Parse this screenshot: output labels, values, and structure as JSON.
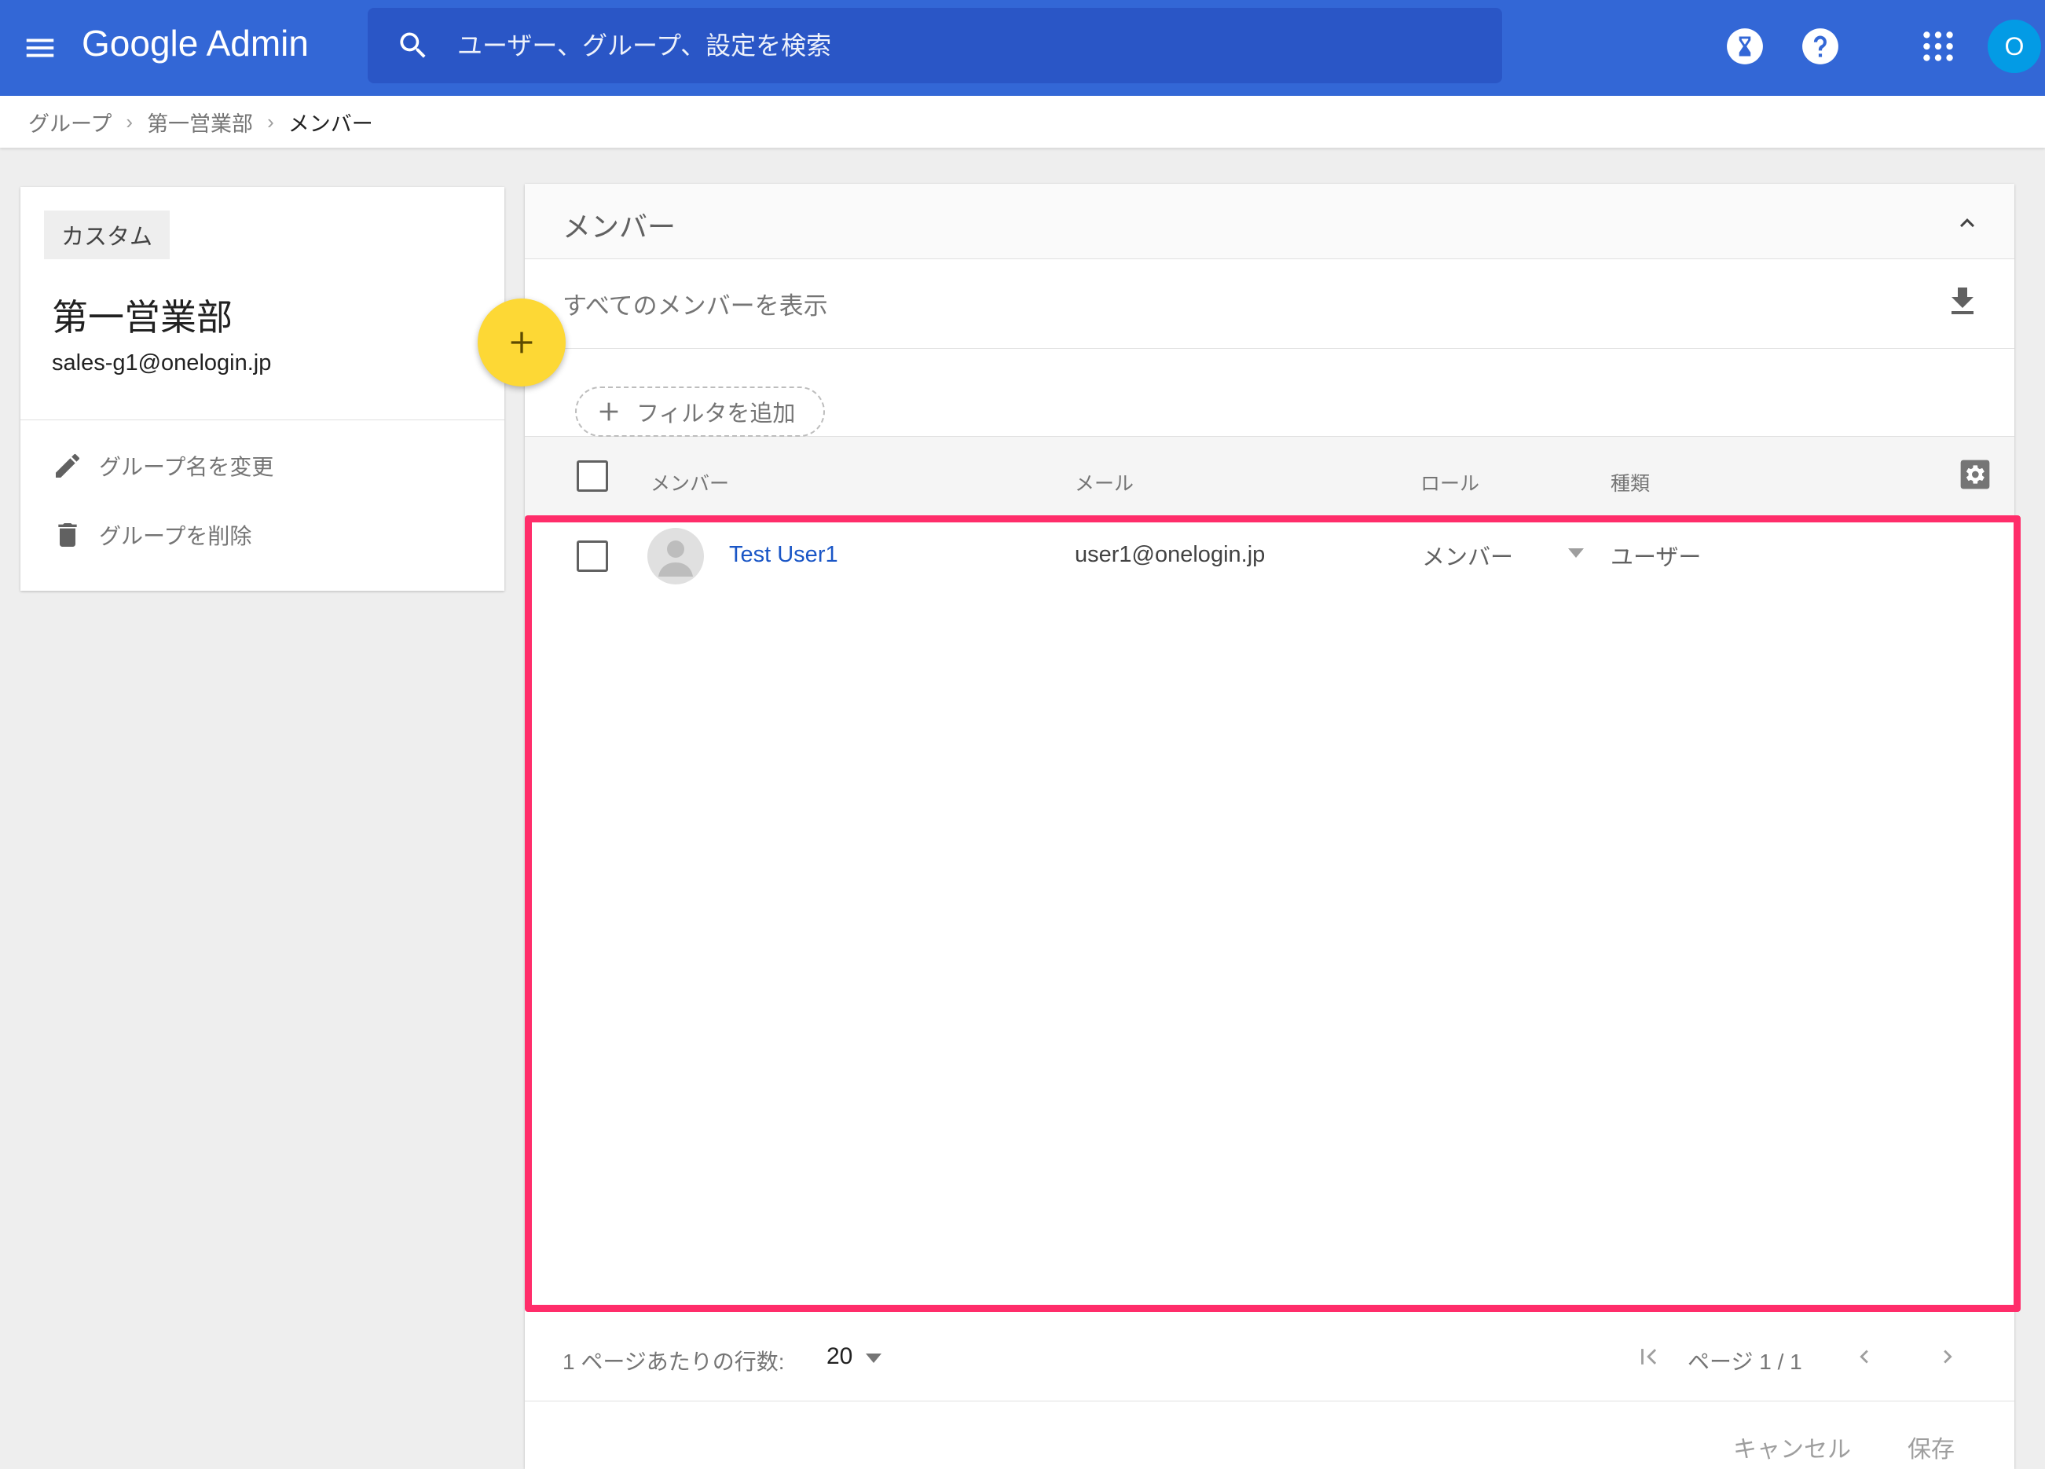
{
  "app": {
    "title": "Google Admin"
  },
  "search": {
    "placeholder": "ユーザー、グループ、設定を検索"
  },
  "account": {
    "initial": "O"
  },
  "breadcrumb": {
    "items": [
      "グループ",
      "第一営業部"
    ],
    "current": "メンバー"
  },
  "group": {
    "chip": "カスタム",
    "name": "第一営業部",
    "email": "sales-g1@onelogin.jp",
    "actions": {
      "rename": "グループ名を変更",
      "delete": "グループを削除"
    }
  },
  "members_panel": {
    "title": "メンバー",
    "show_all": "すべてのメンバーを表示",
    "add_filter": "フィルタを追加",
    "columns": {
      "member": "メンバー",
      "email": "メール",
      "role": "ロール",
      "type": "種類"
    },
    "rows": [
      {
        "name": "Test User1",
        "email": "user1@onelogin.jp",
        "role": "メンバー",
        "type": "ユーザー"
      }
    ]
  },
  "pagination": {
    "rows_per_page_label": "1 ページあたりの行数:",
    "rows_per_page": "20",
    "page": "ページ 1 / 1"
  },
  "footer": {
    "cancel": "キャンセル",
    "save": "保存"
  },
  "colors": {
    "topbar": "#3367d6",
    "search_bg": "#2a56c6",
    "fab": "#fdd835",
    "highlight": "#ff2d6a",
    "link": "#1a56c6",
    "avatar": "#039be5"
  }
}
